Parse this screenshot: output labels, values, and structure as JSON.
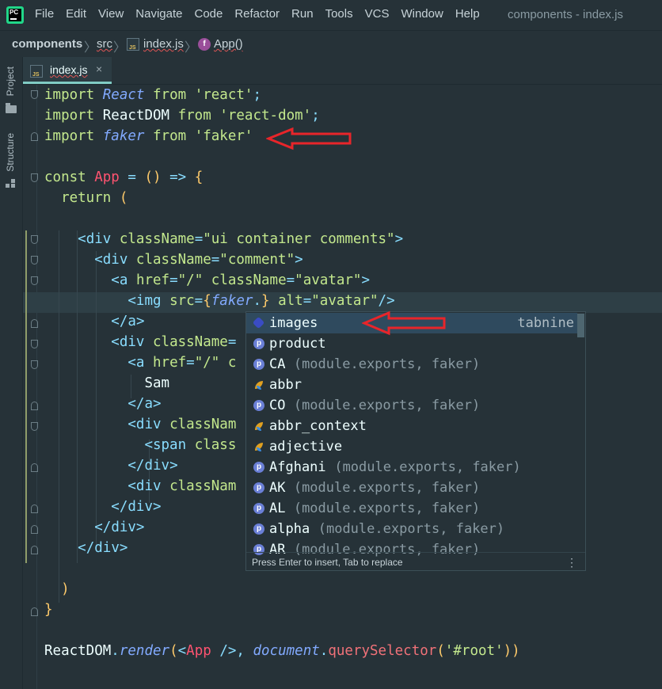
{
  "app": {
    "window_title": "components - index.js",
    "logo_text": "PC"
  },
  "menu": [
    {
      "label": "File"
    },
    {
      "label": "Edit"
    },
    {
      "label": "View"
    },
    {
      "label": "Navigate"
    },
    {
      "label": "Code"
    },
    {
      "label": "Refactor"
    },
    {
      "label": "Run"
    },
    {
      "label": "Tools"
    },
    {
      "label": "VCS"
    },
    {
      "label": "Window"
    },
    {
      "label": "Help"
    }
  ],
  "breadcrumbs": {
    "project": "components",
    "folder": "src",
    "file": "index.js",
    "symbol": "App()",
    "symbol_icon_letter": "f"
  },
  "toolstrip": {
    "project": "Project",
    "structure": "Structure"
  },
  "tabs": [
    {
      "label": "index.js",
      "close": "×"
    }
  ],
  "editor": {
    "lines": [
      "import React from 'react';",
      "import ReactDOM from 'react-dom';",
      "import faker from 'faker'",
      "",
      "const App = () => {",
      "  return (",
      "",
      "    <div className=\"ui container comments\">",
      "      <div className=\"comment\">",
      "        <a href=\"/\" className=\"avatar\">",
      "          <img src={faker.} alt=\"avatar\"/>",
      "        </a>",
      "        <div className=",
      "          <a href=\"/\" c",
      "            Sam",
      "          </a>",
      "          <div classNam",
      "            <span class",
      "          </div>",
      "          <div classNam",
      "        </div>",
      "      </div>",
      "    </div>",
      "",
      "  )",
      "}",
      "",
      "ReactDOM.render(<App />, document.querySelector('#root'))"
    ]
  },
  "autocomplete": {
    "items": [
      {
        "name": "images",
        "tail": "",
        "right": "tabnine",
        "icon": "tabnine-icon",
        "selected": true
      },
      {
        "name": "product",
        "tail": "",
        "right": "",
        "icon": "property-icon"
      },
      {
        "name": "CA",
        "tail": " (module.exports, faker)",
        "right": "",
        "icon": "property-icon"
      },
      {
        "name": "abbr",
        "tail": "",
        "right": "",
        "icon": "function-icon"
      },
      {
        "name": "CO",
        "tail": " (module.exports, faker)",
        "right": "",
        "icon": "property-icon"
      },
      {
        "name": "abbr_context",
        "tail": "",
        "right": "",
        "icon": "function-icon"
      },
      {
        "name": "adjective",
        "tail": "",
        "right": "",
        "icon": "function-icon"
      },
      {
        "name": "Afghani",
        "tail": " (module.exports, faker)",
        "right": "",
        "icon": "property-icon"
      },
      {
        "name": "AK",
        "tail": " (module.exports, faker)",
        "right": "",
        "icon": "property-icon"
      },
      {
        "name": "AL",
        "tail": " (module.exports, faker)",
        "right": "",
        "icon": "property-icon"
      },
      {
        "name": "alpha",
        "tail": " (module.exports, faker)",
        "right": "",
        "icon": "property-icon"
      },
      {
        "name": "AR",
        "tail": " (module.exports, faker)",
        "right": "",
        "icon": "property-icon"
      }
    ],
    "footer": "Press Enter to insert, Tab to replace",
    "more": "⋮"
  },
  "colors": {
    "annotation_arrow": "#e8252a",
    "editor_bg": "#263238",
    "selection": "#2f4a5e"
  }
}
